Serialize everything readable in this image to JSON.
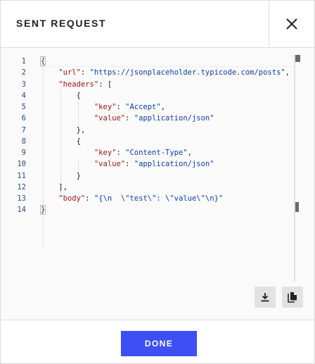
{
  "dialog": {
    "title": "SENT REQUEST",
    "close_icon": "close-icon"
  },
  "editor": {
    "line_numbers": [
      "1",
      "2",
      "3",
      "4",
      "5",
      "6",
      "7",
      "8",
      "9",
      "10",
      "11",
      "12",
      "13",
      "14"
    ],
    "lines": [
      [
        {
          "t": "p",
          "v": "{"
        }
      ],
      [
        {
          "t": "p",
          "v": "    "
        },
        {
          "t": "k",
          "v": "\"url\""
        },
        {
          "t": "p",
          "v": ": "
        },
        {
          "t": "s",
          "v": "\"https://jsonplaceholder.typicode.com/posts\""
        },
        {
          "t": "p",
          "v": ","
        }
      ],
      [
        {
          "t": "p",
          "v": "    "
        },
        {
          "t": "k",
          "v": "\"headers\""
        },
        {
          "t": "p",
          "v": ": ["
        }
      ],
      [
        {
          "t": "p",
          "v": "        {"
        }
      ],
      [
        {
          "t": "p",
          "v": "            "
        },
        {
          "t": "k",
          "v": "\"key\""
        },
        {
          "t": "p",
          "v": ": "
        },
        {
          "t": "s",
          "v": "\"Accept\""
        },
        {
          "t": "p",
          "v": ","
        }
      ],
      [
        {
          "t": "p",
          "v": "            "
        },
        {
          "t": "k",
          "v": "\"value\""
        },
        {
          "t": "p",
          "v": ": "
        },
        {
          "t": "s",
          "v": "\"application/json\""
        }
      ],
      [
        {
          "t": "p",
          "v": "        },"
        }
      ],
      [
        {
          "t": "p",
          "v": "        {"
        }
      ],
      [
        {
          "t": "p",
          "v": "            "
        },
        {
          "t": "k",
          "v": "\"key\""
        },
        {
          "t": "p",
          "v": ": "
        },
        {
          "t": "s",
          "v": "\"Content-Type\""
        },
        {
          "t": "p",
          "v": ","
        }
      ],
      [
        {
          "t": "p",
          "v": "            "
        },
        {
          "t": "k",
          "v": "\"value\""
        },
        {
          "t": "p",
          "v": ": "
        },
        {
          "t": "s",
          "v": "\"application/json\""
        }
      ],
      [
        {
          "t": "p",
          "v": "        }"
        }
      ],
      [
        {
          "t": "p",
          "v": "    ],"
        }
      ],
      [
        {
          "t": "p",
          "v": "    "
        },
        {
          "t": "k",
          "v": "\"body\""
        },
        {
          "t": "p",
          "v": ": "
        },
        {
          "t": "s",
          "v": "\"{\\n  \\\"test\\\": \\\"value\\\"\\n}\""
        }
      ],
      [
        {
          "t": "p",
          "v": "}"
        }
      ]
    ],
    "colors": {
      "key": "#a31515",
      "string": "#0b3fa8",
      "line_number": "#2e4d7a",
      "background": "#fafafa"
    }
  },
  "actions": {
    "download_icon": "download-icon",
    "copy_icon": "copy-icon"
  },
  "footer": {
    "done_label": "DONE",
    "done_color": "#3d4ff5"
  }
}
